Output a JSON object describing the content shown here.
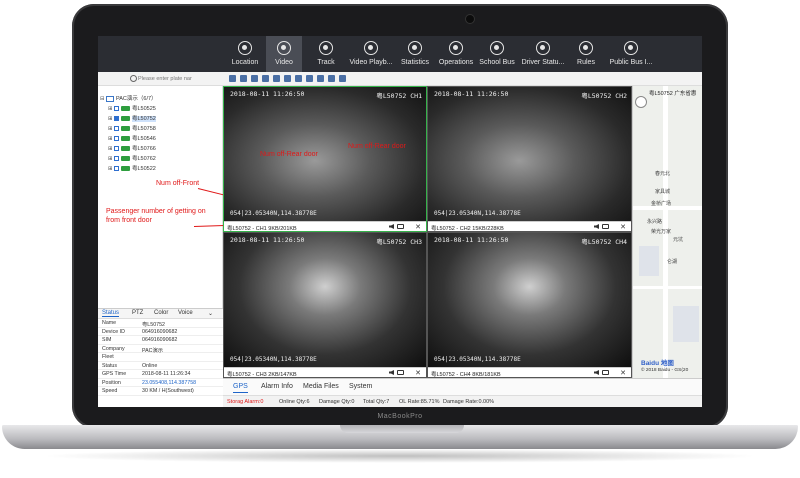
{
  "device": {
    "model": "MacBookPro"
  },
  "nav": {
    "items": [
      {
        "label": "Location",
        "active": false
      },
      {
        "label": "Video",
        "active": true
      },
      {
        "label": "Track",
        "active": false
      },
      {
        "label": "Video Playb...",
        "active": false
      },
      {
        "label": "Statistics",
        "active": false
      },
      {
        "label": "Operations",
        "active": false
      },
      {
        "label": "School Bus",
        "active": false
      },
      {
        "label": "Driver Statu...",
        "active": false
      },
      {
        "label": "Rules",
        "active": false
      },
      {
        "label": "Public Bus I...",
        "active": false
      }
    ]
  },
  "search": {
    "placeholder": "Please enter plate nar"
  },
  "tree": {
    "root": "PAC演示（6/7）",
    "vehicles": [
      "粤L50525",
      "粤L50752",
      "粤L50758",
      "粤L50546",
      "粤L50766",
      "粤L50762",
      "粤L50522"
    ],
    "selected_index": 1
  },
  "annotations": {
    "num_off_front": "Num off-Front",
    "passenger_front_line1": "Passenger number of getting on",
    "passenger_front_line2": "from front door",
    "num_off_rear_1": "Num off-Rear door",
    "num_off_rear_2": "Num off-Rear door"
  },
  "status_panel": {
    "tabs": [
      "Status",
      "PTZ",
      "Color",
      "Voice"
    ],
    "active_tab": "Status",
    "rows": [
      {
        "key": "Name",
        "value": "粤L50752"
      },
      {
        "key": "Device ID",
        "value": "064916090682"
      },
      {
        "key": "SIM",
        "value": "064916090682"
      },
      {
        "key": "Company",
        "value": "PAC演示"
      },
      {
        "key": "Fleet",
        "value": ""
      },
      {
        "key": "Status",
        "value": "Online"
      },
      {
        "key": "GPS Time",
        "value": "2018-08-11 11:26:34"
      },
      {
        "key": "Position",
        "value": "23.055408,114.387758"
      },
      {
        "key": "Speed",
        "value": "30 KM / H(Southwest)"
      }
    ]
  },
  "videos": [
    {
      "timestamp": "2018-08-11 11:26:50",
      "channel": "粤L50752 CH1",
      "osd": "054|23.05340N,114.38778E",
      "footer": "粤L50752 - CH1 9KB/201KB"
    },
    {
      "timestamp": "2018-08-11 11:26:50",
      "channel": "粤L50752 CH2",
      "osd": "054|23.05340N,114.38778E",
      "footer": "粤L50752 - CH2 15KB/228KB"
    },
    {
      "timestamp": "2018-08-11 11:26:50",
      "channel": "粤L50752 CH3",
      "osd": "054|23.05340N,114.38778E",
      "footer": "粤L50752 - CH3 2KB/147KB"
    },
    {
      "timestamp": "2018-08-11 11:26:50",
      "channel": "粤L50752 CH4",
      "osd": "054|23.05340N,114.38778E",
      "footer": "粤L50752 - CH4 8KB/181KB"
    }
  ],
  "map": {
    "plate": "粤L50752 广东省惠",
    "labels": [
      "春元北",
      "家具城",
      "金桥广场",
      "永兴路",
      "荣光万家",
      "仑湖",
      "元坑"
    ],
    "logo": "Baidu 地图",
    "copyright": "© 2018 Baidu - GS(20"
  },
  "bottom_tabs": {
    "items": [
      "GPS",
      "Alarm Info",
      "Media Files",
      "System"
    ],
    "active": "GPS"
  },
  "status_bar": {
    "alarm": "Storag Alarm:0",
    "items": [
      "Online Qty:6",
      "Damage Qty:0",
      "Total Qty:7",
      "OL Rate:85.71%",
      "Damage Rate:0.00%"
    ]
  },
  "colors": {
    "nav_bg": "#2b2d33",
    "accent": "#1e64c8",
    "annotation": "#e01818",
    "active_video_border": "#35b24a"
  }
}
